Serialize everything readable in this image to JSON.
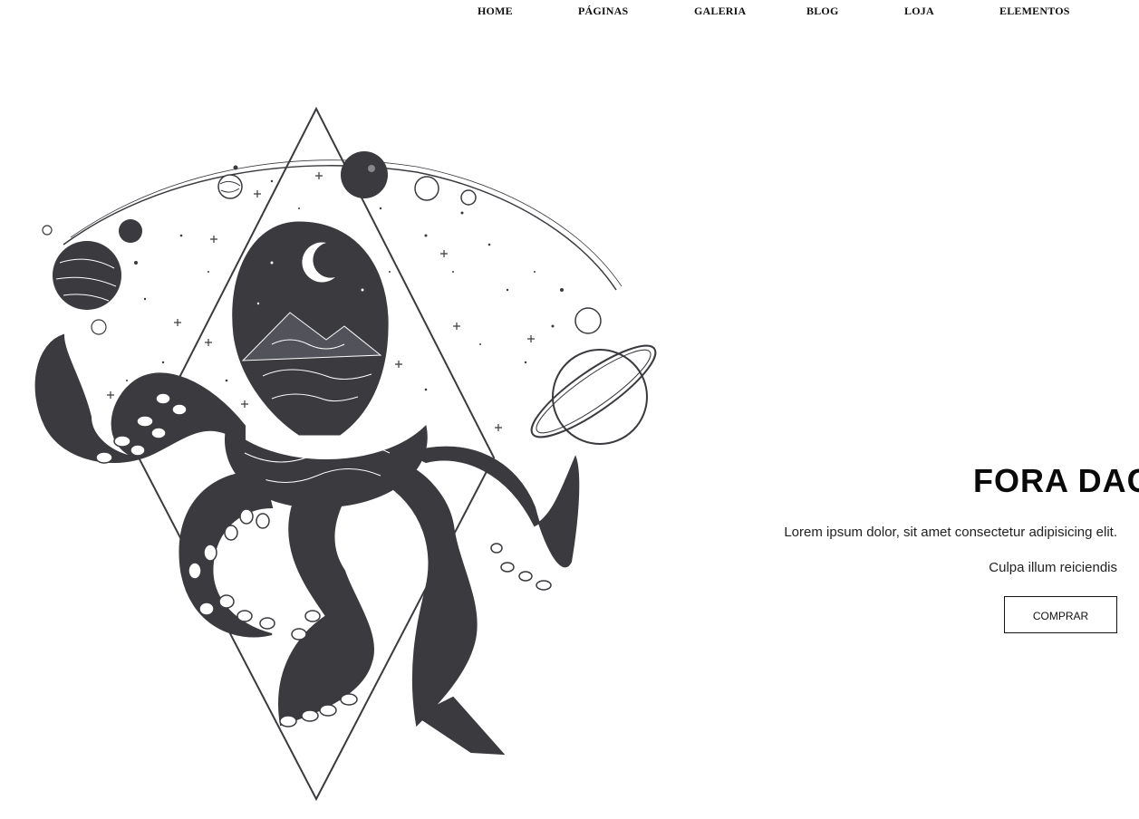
{
  "nav": {
    "items": [
      {
        "label": "HOME"
      },
      {
        "label": "PÁGINAS"
      },
      {
        "label": "GALERIA"
      },
      {
        "label": "BLOG"
      },
      {
        "label": "LOJA"
      },
      {
        "label": "ELEMENTOS"
      }
    ]
  },
  "hero": {
    "title": "FORA DAC",
    "text_line1": "Lorem ipsum dolor, sit amet consectetur adipisicing elit.",
    "text_line2": "Culpa illum reiciendis",
    "button_label": "COMPRAR"
  },
  "artwork": {
    "subject": "octopus-space-illustration-icon",
    "ink_color": "#3a3a3f",
    "background": "#ffffff"
  }
}
